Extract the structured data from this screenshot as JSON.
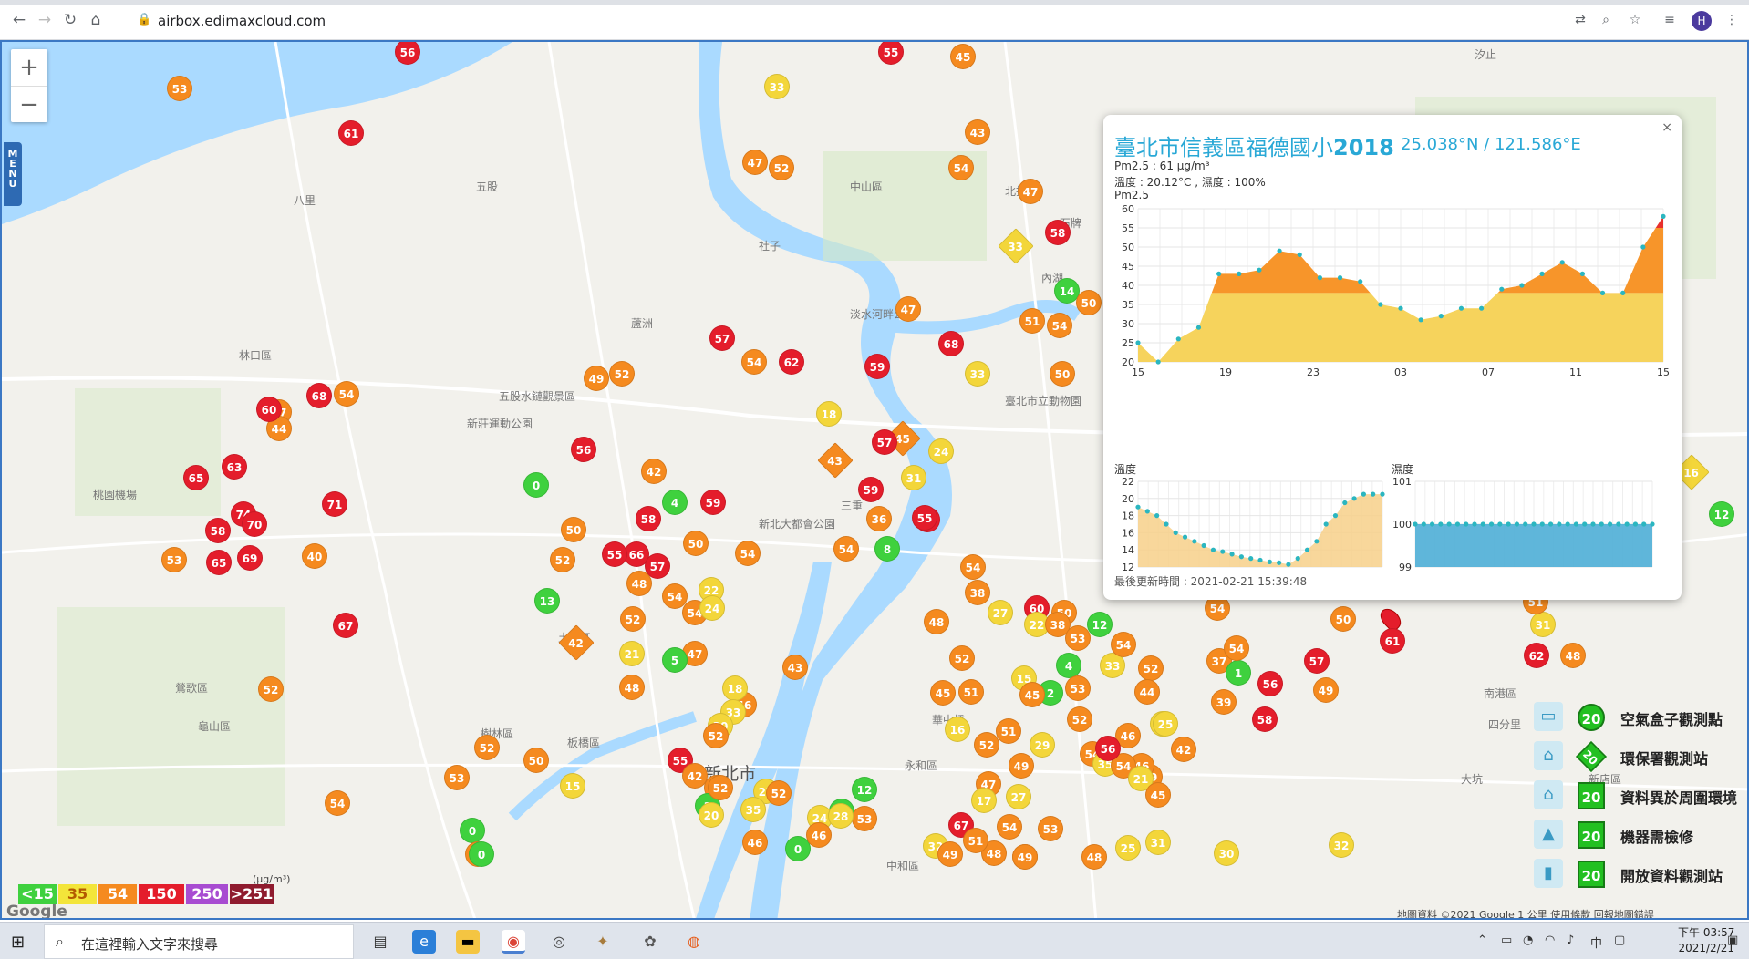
{
  "browser": {
    "url": "airbox.edimaxcloud.com",
    "profile_initial": "H"
  },
  "map": {
    "menu_label": "MENU",
    "zoom_in": "+",
    "zoom_out": "−",
    "places": [
      {
        "t": "新北市",
        "big": true
      },
      {
        "t": "臺北市立動物園"
      },
      {
        "t": "五股",
        "big": false
      },
      {
        "t": "新莊運動公園"
      },
      {
        "t": "五股水鏈觀景區"
      },
      {
        "t": "林口區"
      },
      {
        "t": "蘆洲"
      },
      {
        "t": "三重"
      },
      {
        "t": "板橋區"
      },
      {
        "t": "中和區"
      },
      {
        "t": "永和區"
      },
      {
        "t": "土城區"
      },
      {
        "t": "樹林區"
      },
      {
        "t": "鶯歌區"
      },
      {
        "t": "南港區"
      },
      {
        "t": "汐止"
      },
      {
        "t": "北投"
      },
      {
        "t": "社子"
      },
      {
        "t": "淡水河畔公園"
      },
      {
        "t": "新北大都會公園"
      },
      {
        "t": "華中橋"
      },
      {
        "t": "四分里"
      },
      {
        "t": "大坑"
      },
      {
        "t": "中山區"
      },
      {
        "t": "新店區"
      },
      {
        "t": "龜山區"
      },
      {
        "t": "八里"
      },
      {
        "t": "桃園機場"
      },
      {
        "t": "石牌"
      },
      {
        "t": "內湖"
      }
    ],
    "markers_note": "colored AQI circle markers",
    "legend_unit": "(μg/m³)",
    "legend": [
      {
        "label": "<15",
        "color": "#3fd13e"
      },
      {
        "label": "35",
        "color": "#f3e53a"
      },
      {
        "label": "54",
        "color": "#f58a1f"
      },
      {
        "label": "150",
        "color": "#e41d2b"
      },
      {
        "label": "250",
        "color": "#a84cd1"
      },
      {
        "label": ">251",
        "color": "#8f1b2e"
      }
    ],
    "google_logo": "Google",
    "attribution": "地圖資料 ©2021 Google   1 公里        使用條款   回報地圖錯誤",
    "right_legend": [
      {
        "text": "空氣盒子觀測點",
        "badge": "20"
      },
      {
        "text": "環保署觀測站",
        "badge": "20"
      },
      {
        "text": "資料異於周圍環境",
        "badge": "20"
      },
      {
        "text": "機器需檢修",
        "badge": "20"
      },
      {
        "text": "開放資料觀測站",
        "badge": "20"
      }
    ]
  },
  "popup": {
    "title_main": "臺北市信義區福德國小",
    "title_bold": "2018",
    "coords": "25.038°N / 121.586°E",
    "pm25_line": "Pm2.5 : 61 μg/m³",
    "temp_line": "溫度 : 20.12°C , 濕度 : 100%",
    "chart_label": "Pm2.5",
    "temp_label": "溫度",
    "hum_label": "濕度",
    "updated": "最後更新時間 : 2021-02-21 15:39:48",
    "close": "×"
  },
  "chart_data": [
    {
      "type": "area",
      "title": "Pm2.5",
      "x": [
        "15",
        "",
        "",
        "",
        "19",
        "",
        "",
        "",
        "23",
        "",
        "",
        "",
        "03",
        "",
        "",
        "",
        "07",
        "",
        "",
        "",
        "11",
        "",
        "",
        "",
        "15"
      ],
      "tick_labels": [
        "15",
        "19",
        "23",
        "03",
        "07",
        "11",
        "15"
      ],
      "values": [
        25,
        20,
        26,
        29,
        43,
        43,
        44,
        49,
        48,
        42,
        42,
        41,
        35,
        34,
        31,
        32,
        34,
        34,
        39,
        40,
        43,
        46,
        43,
        38,
        38,
        50,
        58
      ],
      "ylim": [
        20,
        60
      ],
      "yticks": [
        20,
        25,
        30,
        35,
        40,
        45,
        50,
        55,
        60
      ]
    },
    {
      "type": "area",
      "title": "溫度",
      "values": [
        19,
        18.5,
        18,
        17,
        16,
        15.5,
        15,
        14.5,
        14,
        13.8,
        13.5,
        13.2,
        13,
        12.8,
        12.6,
        12.5,
        12.3,
        13,
        14,
        15,
        17,
        18,
        19.5,
        20,
        20.5,
        20.5,
        20.5
      ],
      "ylim": [
        12,
        22
      ],
      "yticks": [
        12,
        14,
        16,
        18,
        20,
        22
      ]
    },
    {
      "type": "area",
      "title": "濕度",
      "values": [
        100,
        100,
        100,
        100,
        100,
        100,
        100,
        100,
        100,
        100,
        100,
        100,
        100,
        100,
        100,
        100,
        100,
        100,
        100,
        100,
        100,
        100,
        100,
        100,
        100,
        100,
        100,
        100,
        100
      ],
      "ylim": [
        99,
        101
      ],
      "yticks": [
        99,
        100,
        101
      ]
    }
  ],
  "taskbar": {
    "search_placeholder": "在這裡輸入文字來搜尋",
    "time": "下午 03:57",
    "date": "2021/2/21",
    "ime": "中"
  }
}
